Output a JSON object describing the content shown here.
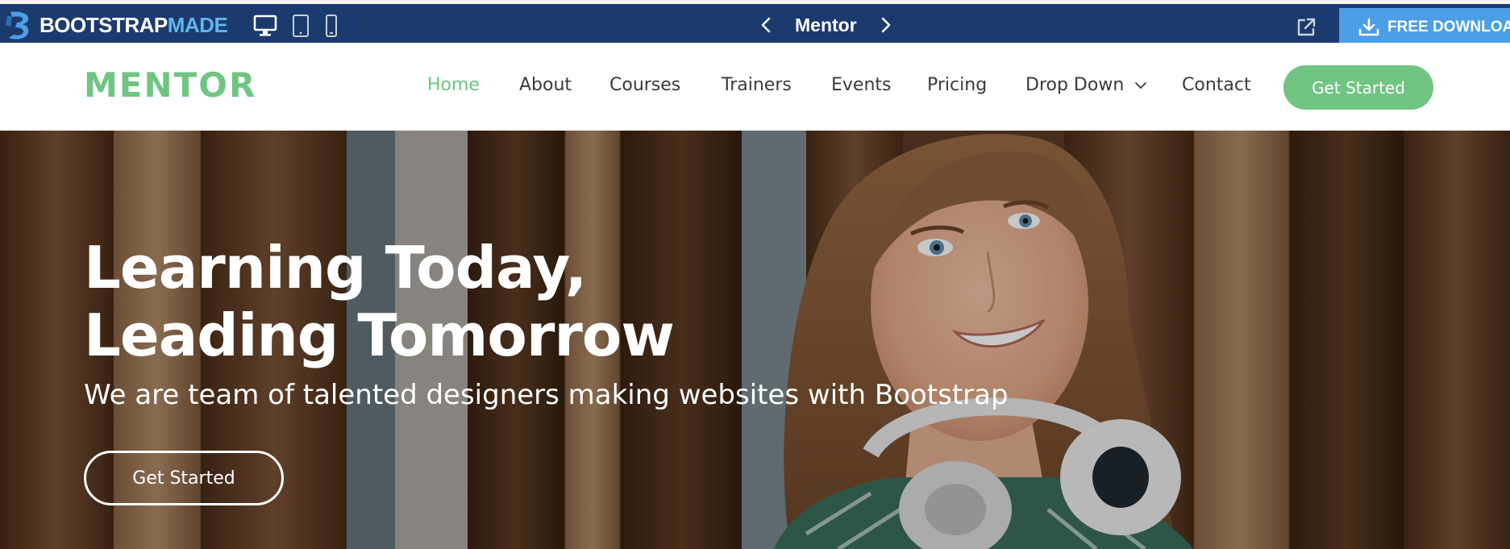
{
  "preview_bar": {
    "brand_part1": "BOOTSTRAP",
    "brand_part2": "MADE",
    "device_icons": [
      "desktop-icon",
      "tablet-icon",
      "mobile-icon"
    ],
    "template_name": "Mentor",
    "download_label": "FREE DOWNLOA",
    "colors": {
      "bar": "#1b3a6d",
      "download": "#4c9ee6",
      "brand_accent": "#5fb6ec"
    }
  },
  "header": {
    "logo": "MENTOR",
    "nav": [
      {
        "label": "Home",
        "active": true
      },
      {
        "label": "About",
        "active": false
      },
      {
        "label": "Courses",
        "active": false
      },
      {
        "label": "Trainers",
        "active": false
      },
      {
        "label": "Events",
        "active": false
      },
      {
        "label": "Pricing",
        "active": false
      },
      {
        "label": "Drop Down",
        "active": false,
        "dropdown": true
      },
      {
        "label": "Contact",
        "active": false
      }
    ],
    "cta_label": "Get Started",
    "colors": {
      "accent": "#6fc581",
      "text": "#3a3a3a"
    }
  },
  "hero": {
    "title_line1": "Learning Today,",
    "title_line2": "Leading Tomorrow",
    "subtitle": "We are team of talented designers making websites with Bootstrap",
    "cta_label": "Get Started"
  }
}
